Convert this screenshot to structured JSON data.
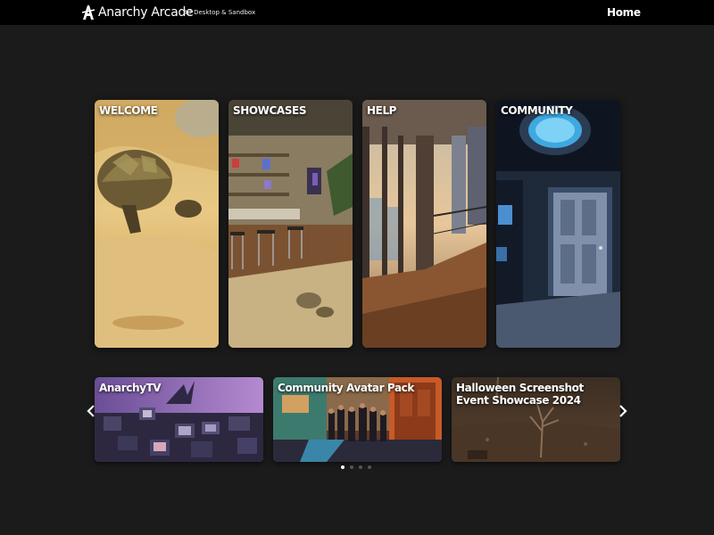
{
  "header": {
    "brand": "Anarchy Arcade",
    "tagline": "3D Desktop & Sandbox",
    "nav_home": "Home",
    "logo_icon": "anarchy-a-icon"
  },
  "cards": [
    {
      "label": "WELCOME",
      "image": "tortoise-in-sand"
    },
    {
      "label": "SHOWCASES",
      "image": "game-room-with-shelves"
    },
    {
      "label": "HELP",
      "image": "apartment-balcony-at-sunset"
    },
    {
      "label": "COMMUNITY",
      "image": "dark-room-with-door"
    }
  ],
  "carousel": {
    "slides": [
      {
        "label": "AnarchyTV",
        "image": "pile-of-crt-televisions"
      },
      {
        "label": "Community Avatar Pack",
        "image": "group-of-avatars-in-room"
      },
      {
        "label": "Halloween Screenshot Event Showcase 2024",
        "image": "barren-tree-at-night"
      }
    ],
    "prev_icon": "chevron-left-icon",
    "next_icon": "chevron-right-icon",
    "page_count": 4,
    "active_page": 1
  },
  "colors": {
    "background": "#1b1b1b",
    "topbar": "#000000",
    "text": "#ffffff"
  }
}
